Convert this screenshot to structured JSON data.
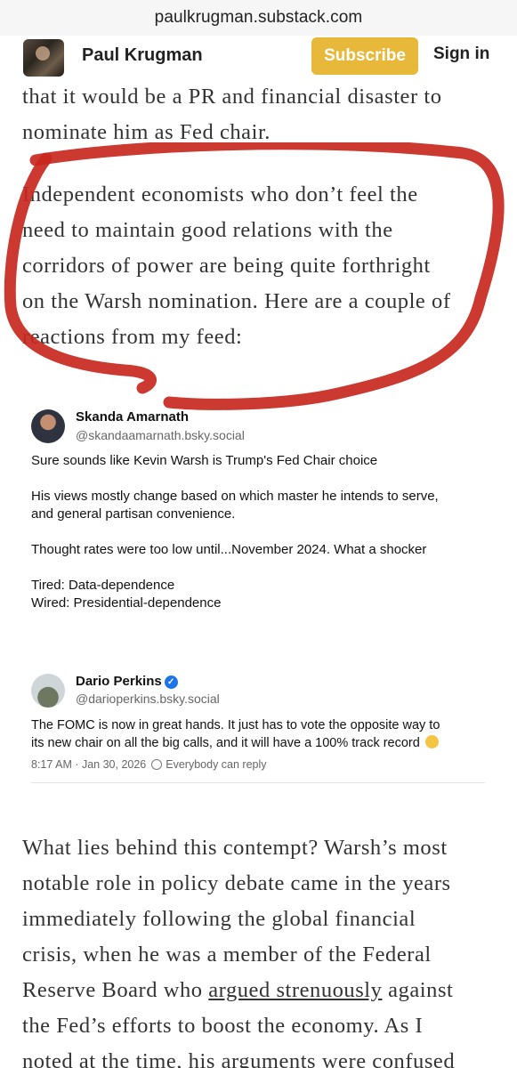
{
  "browser": {
    "url": "paulkrugman.substack.com"
  },
  "header": {
    "publication": "Paul Krugman",
    "subscribe_label": "Subscribe",
    "signin_label": "Sign in"
  },
  "article": {
    "para1": [
      "that it would be a PR and financial disaster to",
      "nominate him as Fed chair."
    ],
    "para2": [
      "Independent economists who don’t feel the",
      "need to maintain good relations with the",
      "corridors of power are being quite forthright",
      "on the Warsh nomination. Here are a couple of",
      "reactions from my feed:"
    ],
    "para3": {
      "lines_before": [
        "What lies behind this contempt? Warsh’s most",
        "notable role in policy debate came in the years",
        "immediately following the global financial",
        "crisis, when he was a member of the Federal"
      ],
      "link_line_prefix": "Reserve Board who ",
      "link_text": "argued strenuously",
      "link_line_suffix": " against",
      "lines_after": [
        "the Fed’s efforts to boost the economy. As I",
        "noted at the time, his arguments were confused"
      ]
    }
  },
  "posts": [
    {
      "name": "Skanda Amarnath",
      "handle": "@skandaamarnath.bsky.social",
      "text": [
        "Sure sounds like Kevin Warsh is Trump's Fed Chair choice",
        "",
        "His views mostly change based on which master he intends to serve,",
        "and general partisan convenience.",
        "",
        "Thought rates were too low until...November 2024. What a shocker",
        "",
        "Tired: Data-dependence",
        "Wired: Presidential-dependence"
      ]
    },
    {
      "name": "Dario Perkins",
      "handle": "@darioperkins.bsky.social",
      "text": [
        "The FOMC is now in great hands. It just has to vote the opposite way to",
        "its new chair on all the big calls, and it will have a 100% track record"
      ],
      "timestamp": "8:17 AM · Jan 30, 2026",
      "reply_setting": "Everybody can reply"
    }
  ],
  "colors": {
    "subscribe_bg": "#e7b83a",
    "marker": "#c8281e",
    "verified": "#1d73e8"
  }
}
